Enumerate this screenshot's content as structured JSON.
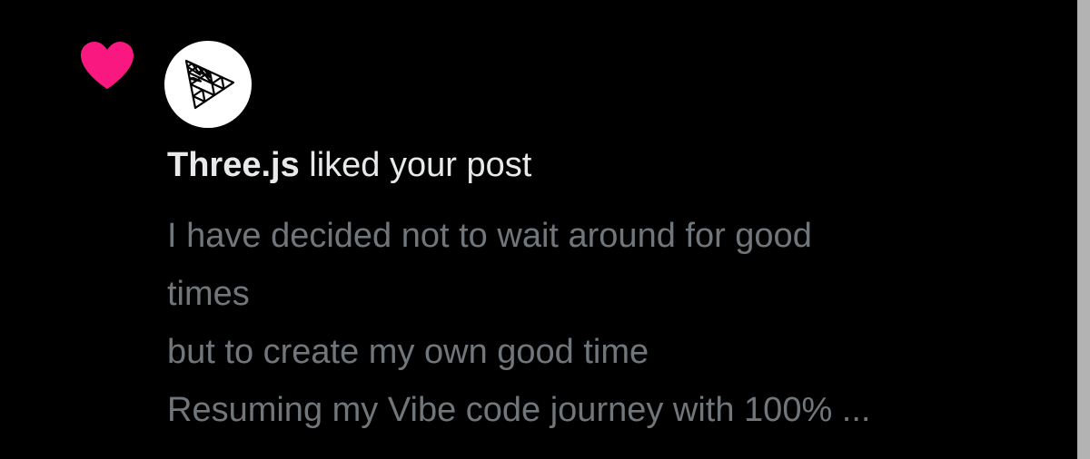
{
  "notification": {
    "type_icon": "heart-icon",
    "heart_color": "#f91880",
    "actor_avatar_icon": "threejs-logo-icon",
    "actor_name": "Three.js",
    "action_text": " liked your post",
    "post_preview_lines": [
      "I have decided not to wait around for good",
      "times",
      "but to create my own good time",
      "Resuming my Vibe code journey with 100% ..."
    ]
  },
  "colors": {
    "background": "#000000",
    "primary_text": "#e7e9ea",
    "secondary_text": "#71767b"
  }
}
